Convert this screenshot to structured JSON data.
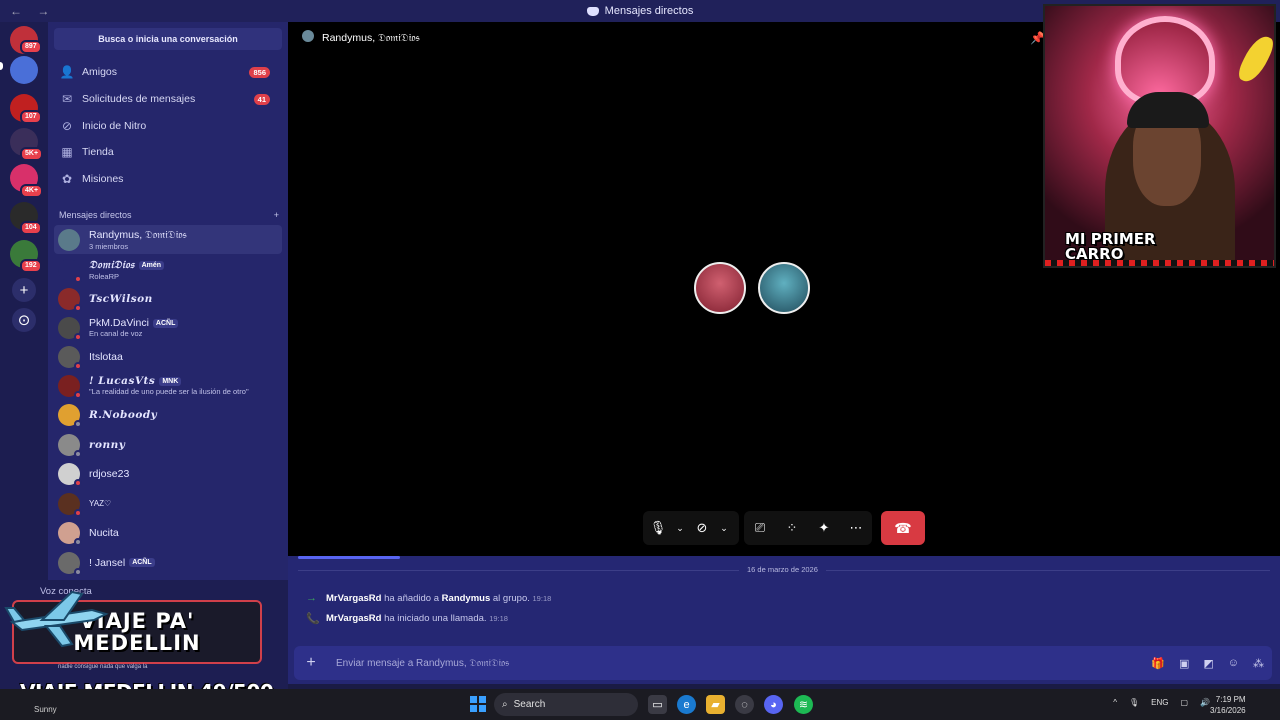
{
  "titlebar": {
    "nav": "← →",
    "title": "Mensajes directos"
  },
  "guilds": [
    {
      "badge": "897",
      "color": "#c0303a"
    },
    {
      "badge": "",
      "color": "#4a6fd8"
    },
    {
      "badge": "107",
      "color": "#c02020"
    },
    {
      "badge": "5K+",
      "color": "#3a2e5a"
    },
    {
      "badge": "4K+",
      "color": "#d8306a"
    },
    {
      "badge": "104",
      "color": "#2a2a2a"
    },
    {
      "badge": "192",
      "color": "#3a7a3a"
    }
  ],
  "sidebar": {
    "search_label": "Busca o inicia una conversación",
    "nav": [
      {
        "label": "Amigos",
        "badge": "856",
        "icon": "👤"
      },
      {
        "label": "Solicitudes de mensajes",
        "badge": "41",
        "icon": "✉"
      },
      {
        "label": "Inicio de Nitro",
        "badge": "",
        "icon": "⊘"
      },
      {
        "label": "Tienda",
        "badge": "",
        "icon": "▦"
      },
      {
        "label": "Misiones",
        "badge": "",
        "icon": "✿"
      }
    ],
    "dm_header": "Mensajes directos",
    "dm_add": "+",
    "dms": [
      {
        "name": "Randymus, 𝔇𝔬𝔪𝔦𝔇𝔦𝔬𝔰",
        "sub": "3 miembros",
        "tag": "",
        "color": "#5a7a8a",
        "status": ""
      },
      {
        "name": "𝔇𝔬𝔪𝔦𝔇𝔦𝔬𝔰",
        "sub": "RoleaRP",
        "tag": "Amén",
        "color": "#25266b",
        "status": "#e0404a"
      },
      {
        "name": "TscWilson",
        "sub": "",
        "tag": "",
        "color": "#8a2a2a",
        "status": "#e0404a"
      },
      {
        "name": "PkM.DaVinci",
        "sub": "En canal de voz",
        "tag": "ACÑL",
        "color": "#4a4a4a",
        "status": "#e0404a"
      },
      {
        "name": "Itslotaa",
        "sub": "",
        "tag": "",
        "color": "#5a5a5a",
        "status": "#e0404a"
      },
      {
        "name": "! LucasVts",
        "sub": "\"La realidad de uno puede ser la ilusión de otro\"",
        "tag": "MNK",
        "color": "#7a2020",
        "status": "#e0404a"
      },
      {
        "name": "R.Noboody",
        "sub": "",
        "tag": "",
        "color": "#e0a030",
        "status": "#8a8aa0"
      },
      {
        "name": "ronny",
        "sub": "",
        "tag": "",
        "color": "#8a8a8a",
        "status": "#8a8aa0"
      },
      {
        "name": "rdjose23",
        "sub": "",
        "tag": "",
        "color": "#d0d0d0",
        "status": "#e0404a"
      },
      {
        "name": "YAZ♡",
        "sub": "",
        "tag": "",
        "color": "#5a3020",
        "status": "#e0404a"
      },
      {
        "name": "Nucita",
        "sub": "",
        "tag": "",
        "color": "#d0a090",
        "status": "#8a8aa0"
      },
      {
        "name": "! Jansel",
        "sub": "",
        "tag": "ACÑL",
        "color": "#6a6a6a",
        "status": "#8a8aa0"
      }
    ]
  },
  "user_panel": {
    "voice_status": "Voz conecta",
    "promo": "VIAJE PA' MEDELLIN",
    "promo_sub": "nadie consigue nada que valga la",
    "overlay_title": "VIAJE MEDELLIN 49/500",
    "weather": "Sunny"
  },
  "call": {
    "title": "Randymus, 𝔇𝔬𝔪𝔦𝔇𝔦𝔬𝔰",
    "participants": [
      {
        "color": "#b03040"
      },
      {
        "color": "#3a8a9a"
      }
    ]
  },
  "webcam": {
    "caption": "MI PRIMER CARRO"
  },
  "chat": {
    "date": "16 de marzo de 2026",
    "messages": [
      {
        "icon": "→",
        "actor": "MrVargasRd",
        "text1": "ha añadido a",
        "target": "Randymus",
        "text2": "al grupo.",
        "time": "19:18"
      },
      {
        "icon": "📞",
        "actor": "MrVargasRd",
        "text1": "ha iniciado una llamada.",
        "target": "",
        "text2": "",
        "time": "19:18"
      }
    ],
    "placeholder": "Enviar mensaje a Randymus, 𝔇𝔬𝔪𝔦𝔇𝔦𝔬𝔰"
  },
  "taskbar": {
    "search": "Search",
    "lang": "ENG",
    "time": "7:19 PM",
    "date": "3/16/2026"
  },
  "colors": {
    "accent": "#5865f2",
    "hangup": "#d83a42",
    "sidebar": "#25266b",
    "chat": "#252773"
  }
}
